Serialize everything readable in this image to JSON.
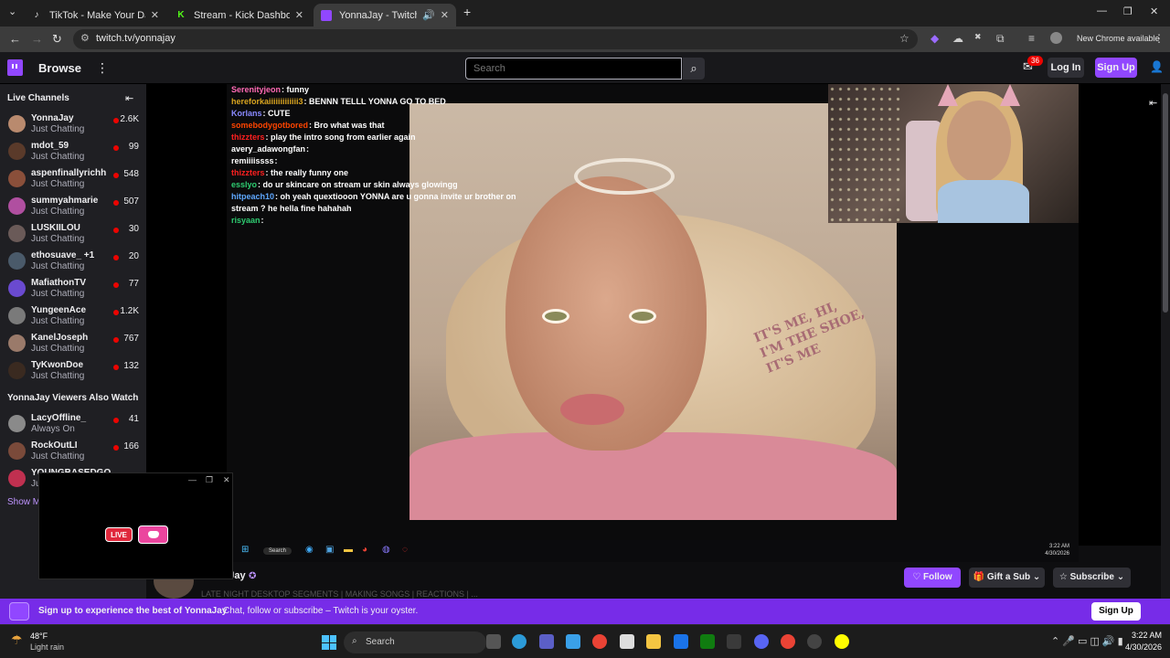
{
  "browser": {
    "tabs": [
      {
        "title": "TikTok - Make Your Day",
        "active": false
      },
      {
        "title": "Stream - Kick Dashboard",
        "active": false
      },
      {
        "title": "YonnaJay - Twitch",
        "active": true
      }
    ],
    "url": "twitch.tv/yonnajay",
    "new_chrome_label": "New Chrome available"
  },
  "twitch_nav": {
    "browse_label": "Browse",
    "search_placeholder": "Search",
    "inbox_badge": "36",
    "login_label": "Log In",
    "signup_label": "Sign Up"
  },
  "sidebar": {
    "live_channels_heading": "Live Channels",
    "channels": [
      {
        "name": "YonnaJay",
        "category": "Just Chatting",
        "viewers": "2.6K",
        "avatar_color": "#b98a6e"
      },
      {
        "name": "mdot_59",
        "category": "Just Chatting",
        "viewers": "99",
        "avatar_color": "#5a3a2a"
      },
      {
        "name": "aspenfinallyrichh",
        "category": "Just Chatting",
        "viewers": "548",
        "avatar_color": "#8a4f3a"
      },
      {
        "name": "summyahmarie",
        "category": "Just Chatting",
        "viewers": "507",
        "avatar_color": "#b04fa0"
      },
      {
        "name": "LUSKIILOU",
        "category": "Just Chatting",
        "viewers": "30",
        "avatar_color": "#6a5a58"
      },
      {
        "name": "ethosuave_ +1",
        "category": "Just Chatting",
        "viewers": "20",
        "avatar_color": "#4a5a6a"
      },
      {
        "name": "MafiathonTV",
        "category": "Just Chatting",
        "viewers": "77",
        "avatar_color": "#6a4ad0"
      },
      {
        "name": "YungeenAce",
        "category": "Just Chatting",
        "viewers": "1.2K",
        "avatar_color": "#7a7a7a"
      },
      {
        "name": "KanelJoseph",
        "category": "Just Chatting",
        "viewers": "767",
        "avatar_color": "#9a7a6a"
      },
      {
        "name": "TyKwonDoe",
        "category": "Just Chatting",
        "viewers": "132",
        "avatar_color": "#3a2a20"
      }
    ],
    "also_watch_heading": "YonnaJay Viewers Also Watch",
    "also_watch": [
      {
        "name": "LacyOffline_",
        "category": "Always On",
        "viewers": "41",
        "avatar_color": "#8a8a8a"
      },
      {
        "name": "RockOutLI",
        "category": "Just Chatting",
        "viewers": "166",
        "avatar_color": "#7a4a3a"
      },
      {
        "name": "YOUNGBASEDGO...",
        "category": "Ju",
        "viewers": "",
        "avatar_color": "#c03050"
      }
    ],
    "show_more": "Show M"
  },
  "chat": [
    {
      "user": "Serenityjeon",
      "color": "#ff69b4",
      "text": "funny"
    },
    {
      "user": "hereforkaiiiiiiiiiiiii3",
      "color": "#daa520",
      "text": "BENNN TELLL YONNA GO TO BED"
    },
    {
      "user": "Korlans",
      "color": "#8a8aff",
      "text": "CUTE"
    },
    {
      "user": "somebodygotbored",
      "color": "#ff4500",
      "text": "Bro what was that"
    },
    {
      "user": "thizzters",
      "color": "#ff2020",
      "text": "play the intro song from earlier again"
    },
    {
      "user": "avery_adawongfan",
      "color": "#ffffff",
      "text": ""
    },
    {
      "user": "remiiiissss",
      "color": "#ffffff",
      "text": ""
    },
    {
      "user": "thizzters",
      "color": "#ff2020",
      "text": "the really funny one"
    },
    {
      "user": "esslyo",
      "color": "#2ecc71",
      "text": "do ur skincare on stream ur skin always glowingg"
    },
    {
      "user": "hitpeach10",
      "color": "#5fa8ff",
      "text": "oh yeah quextiooon YONNA are u gonna invite ur brother on"
    },
    {
      "user": "",
      "color": "#ffffff",
      "text": "stream ? he hella fine hahahah"
    },
    {
      "user": "risyaan",
      "color": "#2ecc71",
      "text": ""
    }
  ],
  "overlay_text": {
    "shoe_caption": [
      "IT'S ME, HI,",
      "I'M THE SHOE,",
      "IT'S ME"
    ]
  },
  "stream_taskbar": {
    "search_label": "Search",
    "time": "3:22 AM",
    "date": "4/30/2026"
  },
  "channel_bar": {
    "name": "onnaJay",
    "title_fragment": "LATE NIGHT DESKTOP SEGMENTS | MAKING SONGS | REACTIONS | ...",
    "follow_label": "Follow",
    "gift_label": "Gift a Sub",
    "subscribe_label": "Subscribe"
  },
  "mini_window": {
    "live_label": "LIVE"
  },
  "banner": {
    "bold": "Sign up to experience the best of YonnaJay",
    "text": "Chat, follow or subscribe – Twitch is your oyster.",
    "button": "Sign Up"
  },
  "taskbar": {
    "temperature": "48°F",
    "condition": "Light rain",
    "search_label": "Search",
    "time": "3:22 AM",
    "date": "4/30/2026"
  },
  "colors": {
    "twitch_purple": "#9147ff",
    "banner_purple": "#772ce8",
    "live_red": "#eb0400"
  }
}
